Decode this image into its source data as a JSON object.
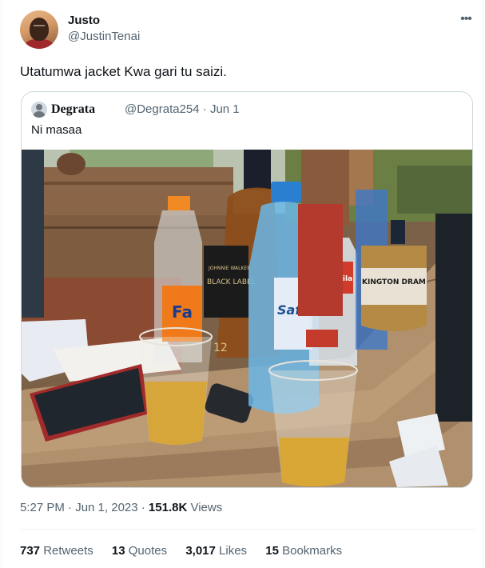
{
  "author": {
    "name": "Justo",
    "handle": "@JustinTenai"
  },
  "tweet": {
    "text": "Utatumwa jacket Kwa gari tu saizi."
  },
  "more_label": "•••",
  "quoted": {
    "name": "Degrata",
    "meta": "@Degrata254 · Jun 1",
    "text": "Ni masaa",
    "photo_labels": {
      "whisky_label": "BLACK LABEL",
      "whisky_brand": "JOHNNIE WALKER",
      "whisky_age": "12",
      "water_label": "Safari",
      "soda_label": "Fa",
      "tequila_label": "Tequila",
      "dram_label": "KINGTON DRAM"
    }
  },
  "timestamp": {
    "time_date": "5:27 PM · Jun 1, 2023 · ",
    "views_count": "151.8K",
    "views_label": "Views"
  },
  "stats": [
    {
      "count": "737",
      "label": "Retweets"
    },
    {
      "count": "13",
      "label": "Quotes"
    },
    {
      "count": "3,017",
      "label": "Likes"
    },
    {
      "count": "15",
      "label": "Bookmarks"
    }
  ],
  "colors": {
    "text": "#0f1419",
    "secondary": "#536471",
    "border": "#cfd9de",
    "divider": "#eff3f4"
  }
}
